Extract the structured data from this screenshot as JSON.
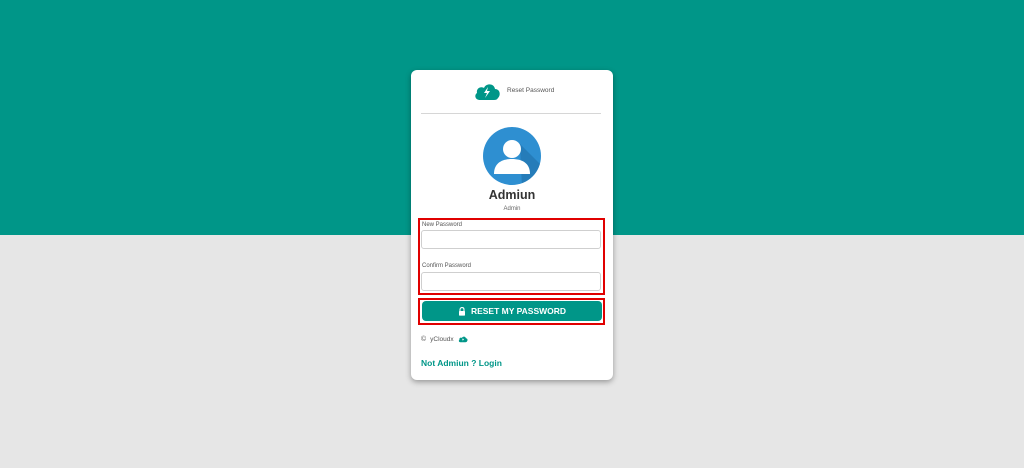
{
  "header": {
    "title": "Reset Password",
    "logo_icon": "cloud-lightning-icon"
  },
  "user": {
    "name": "Admiun",
    "role": "Admin",
    "avatar_icon": "user-avatar-icon"
  },
  "form": {
    "new_password_label": "New Password",
    "new_password_value": "",
    "confirm_password_label": "Confirm Password",
    "confirm_password_value": "",
    "submit_label": "RESET MY PASSWORD",
    "submit_icon": "lock-icon"
  },
  "footer": {
    "copyright_symbol": "©",
    "brand": "yCloudx"
  },
  "login_link": "Not Admiun ? Login",
  "colors": {
    "accent": "#009688",
    "page_bottom": "#e6e6e6",
    "avatar_blue": "#2e8fd1",
    "highlight_red": "#e00000"
  }
}
